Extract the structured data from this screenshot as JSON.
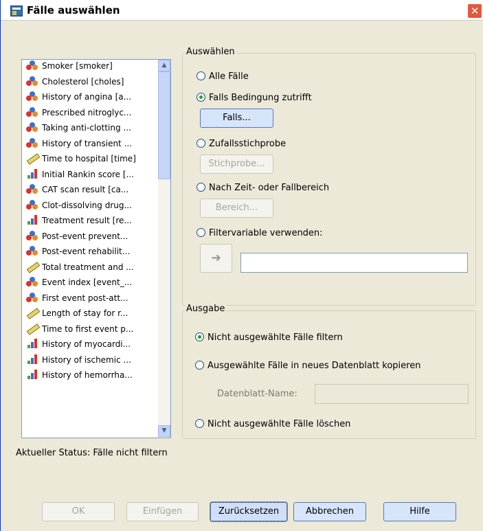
{
  "window": {
    "title": "Fälle auswählen",
    "close_glyph": "✕"
  },
  "variables": [
    {
      "label": "Smoker [smoker]",
      "icon": "nominal"
    },
    {
      "label": "Cholesterol [choles]",
      "icon": "nominal"
    },
    {
      "label": "History of angina [a...",
      "icon": "nominal"
    },
    {
      "label": "Prescribed nitroglyc...",
      "icon": "nominal"
    },
    {
      "label": "Taking anti-clotting ...",
      "icon": "nominal"
    },
    {
      "label": "History of transient ...",
      "icon": "nominal"
    },
    {
      "label": "Time to hospital [time]",
      "icon": "scale"
    },
    {
      "label": "Initial Rankin score [...",
      "icon": "ordinal"
    },
    {
      "label": "CAT scan result [ca...",
      "icon": "nominal"
    },
    {
      "label": "Clot-dissolving drug...",
      "icon": "nominal"
    },
    {
      "label": "Treatment result [re...",
      "icon": "ordinal"
    },
    {
      "label": "Post-event prevent...",
      "icon": "nominal"
    },
    {
      "label": "Post-event rehabilit...",
      "icon": "nominal"
    },
    {
      "label": "Total treatment and ...",
      "icon": "scale"
    },
    {
      "label": "Event index [event_...",
      "icon": "nominal"
    },
    {
      "label": "First event post-att...",
      "icon": "nominal"
    },
    {
      "label": "Length of stay for r...",
      "icon": "scale"
    },
    {
      "label": "Time to first event p...",
      "icon": "scale"
    },
    {
      "label": "History of myocardi...",
      "icon": "ordinal"
    },
    {
      "label": "History of ischemic ...",
      "icon": "ordinal"
    },
    {
      "label": "History of hemorrha...",
      "icon": "ordinal"
    }
  ],
  "select": {
    "legend": "Auswählen",
    "all_cases": "Alle Fälle",
    "if_condition": "Falls Bedingung zutrifft",
    "if_button": "Falls...",
    "random_sample": "Zufallsstichprobe",
    "sample_button": "Stichprobe...",
    "range": "Nach Zeit- oder Fallbereich",
    "range_button": "Bereich...",
    "filter_variable": "Filtervariable verwenden:",
    "selected_option": "if_condition"
  },
  "output": {
    "legend": "Ausgabe",
    "filter_unselected": "Nicht ausgewählte Fälle filtern",
    "copy_to_dataset": "Ausgewählte Fälle in neues Datenblatt kopieren",
    "dataset_name_label": "Datenblatt-Name:",
    "dataset_name_value": "",
    "delete_unselected": "Nicht ausgewählte Fälle löschen",
    "selected_option": "filter_unselected"
  },
  "status": "Aktueller Status: Fälle nicht filtern",
  "buttons": {
    "ok": "OK",
    "paste": "Einfügen",
    "reset": "Zurücksetzen",
    "cancel": "Abbrechen",
    "help": "Hilfe"
  }
}
